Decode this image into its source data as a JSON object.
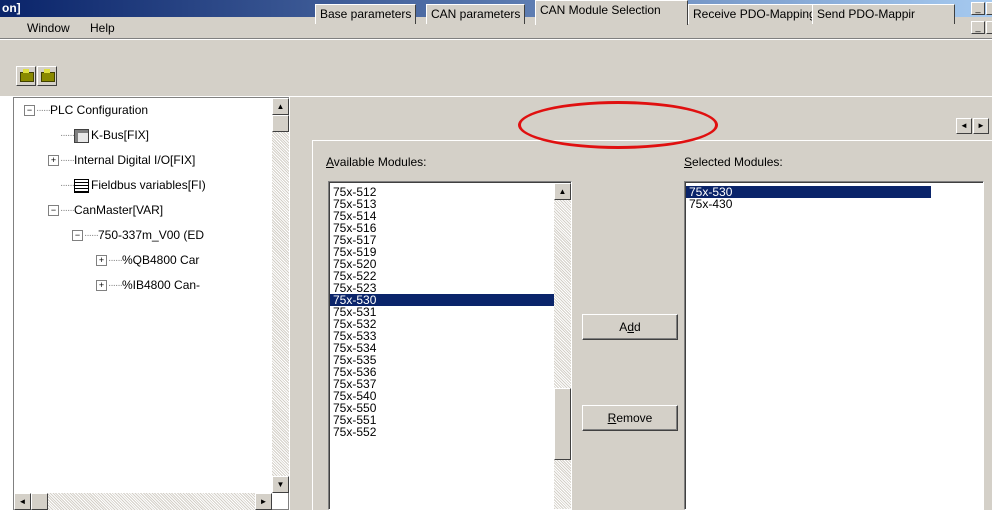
{
  "window": {
    "title": "on]",
    "min_glyph": "_",
    "restore_glyph": "▯"
  },
  "menu": {
    "items": [
      "Window",
      "Help"
    ]
  },
  "toolbar": {
    "buttons": [
      "tool-button-1",
      "tool-button-2"
    ]
  },
  "tree": {
    "items": [
      {
        "label": "PLC Configuration",
        "expander": "⊟",
        "indent": 0
      },
      {
        "label": "K-Bus[FIX]",
        "expander": "",
        "indent": 1,
        "icon": "kbus-icon"
      },
      {
        "label": "Internal Digital I/O[FIX]",
        "expander": "⊞",
        "indent": 1
      },
      {
        "label": "Fieldbus variables[FI)",
        "expander": "",
        "indent": 1,
        "icon": "grid-icon"
      },
      {
        "label": "CanMaster[VAR]",
        "expander": "⊟",
        "indent": 1
      },
      {
        "label": "750-337m_V00 (ED",
        "expander": "⊟",
        "indent": 2
      },
      {
        "label": "%QB4800 Car",
        "expander": "⊞",
        "indent": 3
      },
      {
        "label": "%IB4800 Can-",
        "expander": "⊞",
        "indent": 3
      }
    ]
  },
  "tabs": {
    "items": [
      {
        "label": "Base parameters"
      },
      {
        "label": "CAN parameters"
      },
      {
        "label": "CAN Module Selection"
      },
      {
        "label": "Receive PDO-Mapping"
      },
      {
        "label": "Send PDO-Mappir"
      }
    ],
    "active": 2,
    "scroll_left": "◄",
    "scroll_right": "►"
  },
  "panel": {
    "available_label_u": "A",
    "available_label_rest": "vailable Modules:",
    "selected_label_u": "S",
    "selected_label_rest": "elected Modules:",
    "add_pre": "A",
    "add_u": "d",
    "add_post": "d",
    "remove_u": "R",
    "remove_rest": "emove",
    "available": [
      "75x-512",
      "75x-513",
      "75x-514",
      "75x-516",
      "75x-517",
      "75x-519",
      "75x-520",
      "75x-522",
      "75x-523",
      "75x-530",
      "75x-531",
      "75x-532",
      "75x-533",
      "75x-534",
      "75x-535",
      "75x-536",
      "75x-537",
      "75x-540",
      "75x-550",
      "75x-551",
      "75x-552"
    ],
    "available_selected": "75x-530",
    "selected": [
      "75x-530",
      "75x-430"
    ],
    "selected_selected": "75x-530"
  },
  "annotation": {
    "color": "#e01010"
  }
}
